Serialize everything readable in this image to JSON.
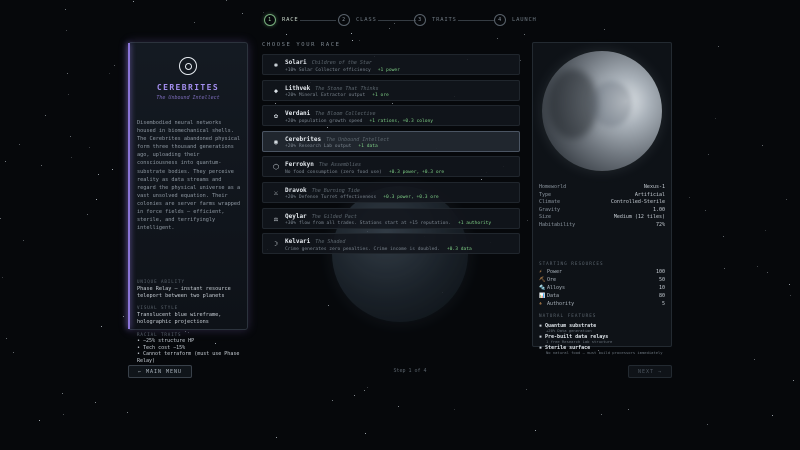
{
  "stepper": [
    {
      "num": "1",
      "label": "RACE",
      "active": true
    },
    {
      "num": "2",
      "label": "CLASS",
      "active": false
    },
    {
      "num": "3",
      "label": "TRAITS",
      "active": false
    },
    {
      "num": "4",
      "label": "LAUNCH",
      "active": false
    }
  ],
  "selected_race": {
    "name": "CEREBRITES",
    "subtitle": "The Unbound Intellect",
    "description": "Disembodied neural networks housed in biomechanical shells. The Cerebrites abandoned physical form three thousand generations ago, uploading their consciousness into quantum-substrate bodies. They perceive reality as data streams and regard the physical universe as a vast unsolved equation. Their colonies are server farms wrapped in force fields — efficient, sterile, and terrifyingly intelligent.",
    "unique_ability_label": "UNIQUE ABILITY",
    "unique_ability": "Phase Relay — instant resource teleport between two planets",
    "visual_style_label": "VISUAL STYLE",
    "visual_style": "Translucent blue wireframe, holographic projections",
    "racial_traits_label": "RACIAL TRAITS",
    "racial_traits": [
      "• −25% structure HP",
      "• Tech cost −15%",
      "• Cannot terraform (must use Phase Relay)"
    ]
  },
  "choose_heading": "CHOOSE YOUR RACE",
  "races": [
    {
      "icon": "✺",
      "icon_name": "sun-icon",
      "name": "Solari",
      "tagline": "Children of the Star",
      "effect": "+10% Solar Collector efficiency",
      "bonus": "+1 power",
      "selected": false
    },
    {
      "icon": "◆",
      "icon_name": "diamond-icon",
      "name": "Lithvek",
      "tagline": "The Stone That Thinks",
      "effect": "+20% Mineral Extractor output",
      "bonus": "+1 ore",
      "selected": false
    },
    {
      "icon": "✿",
      "icon_name": "leaf-icon",
      "name": "Verdani",
      "tagline": "The Bloom Collective",
      "effect": "+20% population growth speed",
      "bonus": "+1 rations, +0.3 colony",
      "selected": false
    },
    {
      "icon": "◉",
      "icon_name": "brain-icon",
      "name": "Cerebrites",
      "tagline": "The Unbound Intellect",
      "effect": "+20% Research Lab output",
      "bonus": "+1 data",
      "selected": true
    },
    {
      "icon": "⬡",
      "icon_name": "gear-icon",
      "name": "Ferrokyn",
      "tagline": "The Assemblies",
      "effect": "No food consumption (zero food use)",
      "bonus": "+0.3 power, +0.3 ore",
      "selected": false
    },
    {
      "icon": "⚔",
      "icon_name": "swords-icon",
      "name": "Dravok",
      "tagline": "The Burning Tide",
      "effect": "+20% Defense Turret effectiveness",
      "bonus": "+0.3 power, +0.3 ore",
      "selected": false
    },
    {
      "icon": "⚖",
      "icon_name": "scales-icon",
      "name": "Qeylar",
      "tagline": "The Gilded Pact",
      "effect": "+30% flow from all trades. Stations start at +15 reputation.",
      "bonus": "+1 authority",
      "selected": false
    },
    {
      "icon": "☽",
      "icon_name": "moon-icon",
      "name": "Kelvari",
      "tagline": "The Shaded",
      "effect": "Crime generates zero penalties. Crime income is doubled.",
      "bonus": "+0.3 data",
      "selected": false
    }
  ],
  "homeworld": [
    {
      "k": "Homeworld",
      "v": "Nexus-1"
    },
    {
      "k": "Type",
      "v": "Artificial"
    },
    {
      "k": "Climate",
      "v": "Controlled-Sterile"
    },
    {
      "k": "Gravity",
      "v": "1.00"
    },
    {
      "k": "Size",
      "v": "Medium (12 tiles)"
    },
    {
      "k": "Habitability",
      "v": "72%"
    }
  ],
  "resources_label": "STARTING RESOURCES",
  "resources": [
    {
      "icon": "⚡",
      "icon_name": "power-icon",
      "k": "Power",
      "v": "100"
    },
    {
      "icon": "⛏",
      "icon_name": "pickaxe-icon",
      "k": "Ore",
      "v": "50"
    },
    {
      "icon": "🔩",
      "icon_name": "alloy-icon",
      "k": "Alloys",
      "v": "10"
    },
    {
      "icon": "📊",
      "icon_name": "data-icon",
      "k": "Data",
      "v": "80"
    },
    {
      "icon": "⚜",
      "icon_name": "authority-icon",
      "k": "Authority",
      "v": "5"
    }
  ],
  "features_label": "NATURAL FEATURES",
  "features": [
    {
      "title": "Quantum substrate",
      "desc": "+20% Data generation"
    },
    {
      "title": "Pre-built data relays",
      "desc": "1 free Research Lab structure"
    },
    {
      "title": "Sterile surface",
      "desc": "No natural food — must build processors immediately"
    }
  ],
  "footer": {
    "main_menu": "← MAIN MENU",
    "step": "Step 1 of 4",
    "next": "NEXT →"
  },
  "colors": {
    "accent_purple": "#8a74d8",
    "bonus_green": "#7fcf86",
    "resource_orange": "#e6a25a"
  }
}
